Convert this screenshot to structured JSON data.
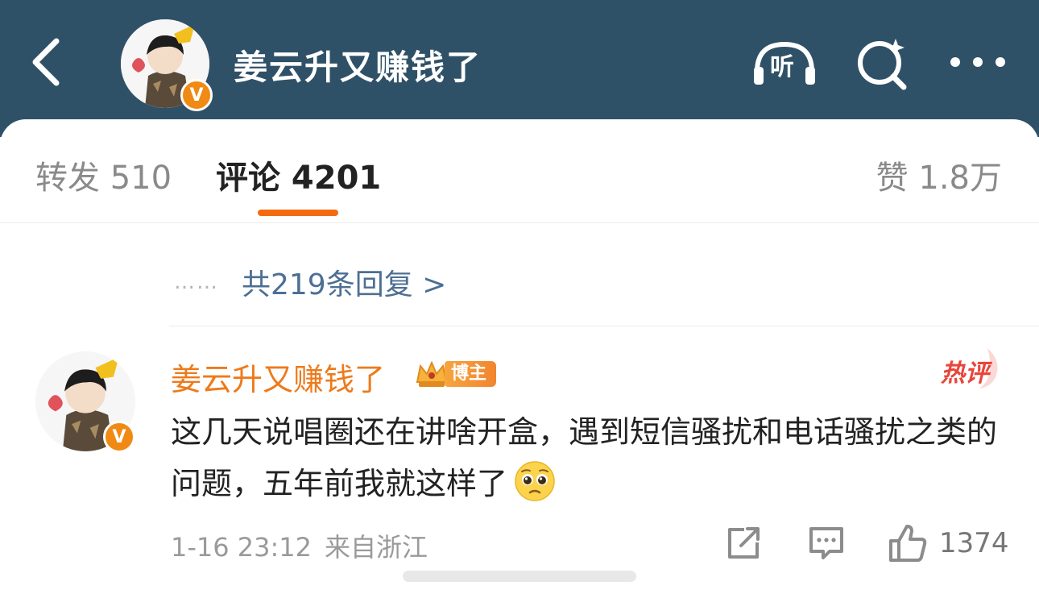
{
  "header": {
    "title": "姜云升又赚钱了",
    "listen_label": "听",
    "verified_mark": "V"
  },
  "tabs": [
    {
      "label": "转发 510"
    },
    {
      "label": "评论 4201"
    },
    {
      "label": "赞 1.8万"
    }
  ],
  "replies": {
    "dots": "……",
    "label": "共219条回复 >"
  },
  "comment": {
    "author": "姜云升又赚钱了",
    "badge": "博主",
    "hot_tag": "热评",
    "text": "这几天说唱圈还在讲啥开盒，遇到短信骚扰和电话骚扰之类的问题，五年前我就这样了",
    "emoji": "pleading-face",
    "time": "1-16 23:12",
    "location": "来自浙江",
    "likes": "1374"
  },
  "colors": {
    "header_bg": "#2f5168",
    "accent": "#f36b0f",
    "author_name": "#ee7a1a",
    "link": "#4d6f94",
    "hot": "#e8453a"
  },
  "icons": [
    "back-arrow-icon",
    "listen-headphones-icon",
    "search-sparkle-icon",
    "more-dots-icon",
    "crown-icon",
    "share-icon",
    "reply-icon",
    "like-icon"
  ]
}
